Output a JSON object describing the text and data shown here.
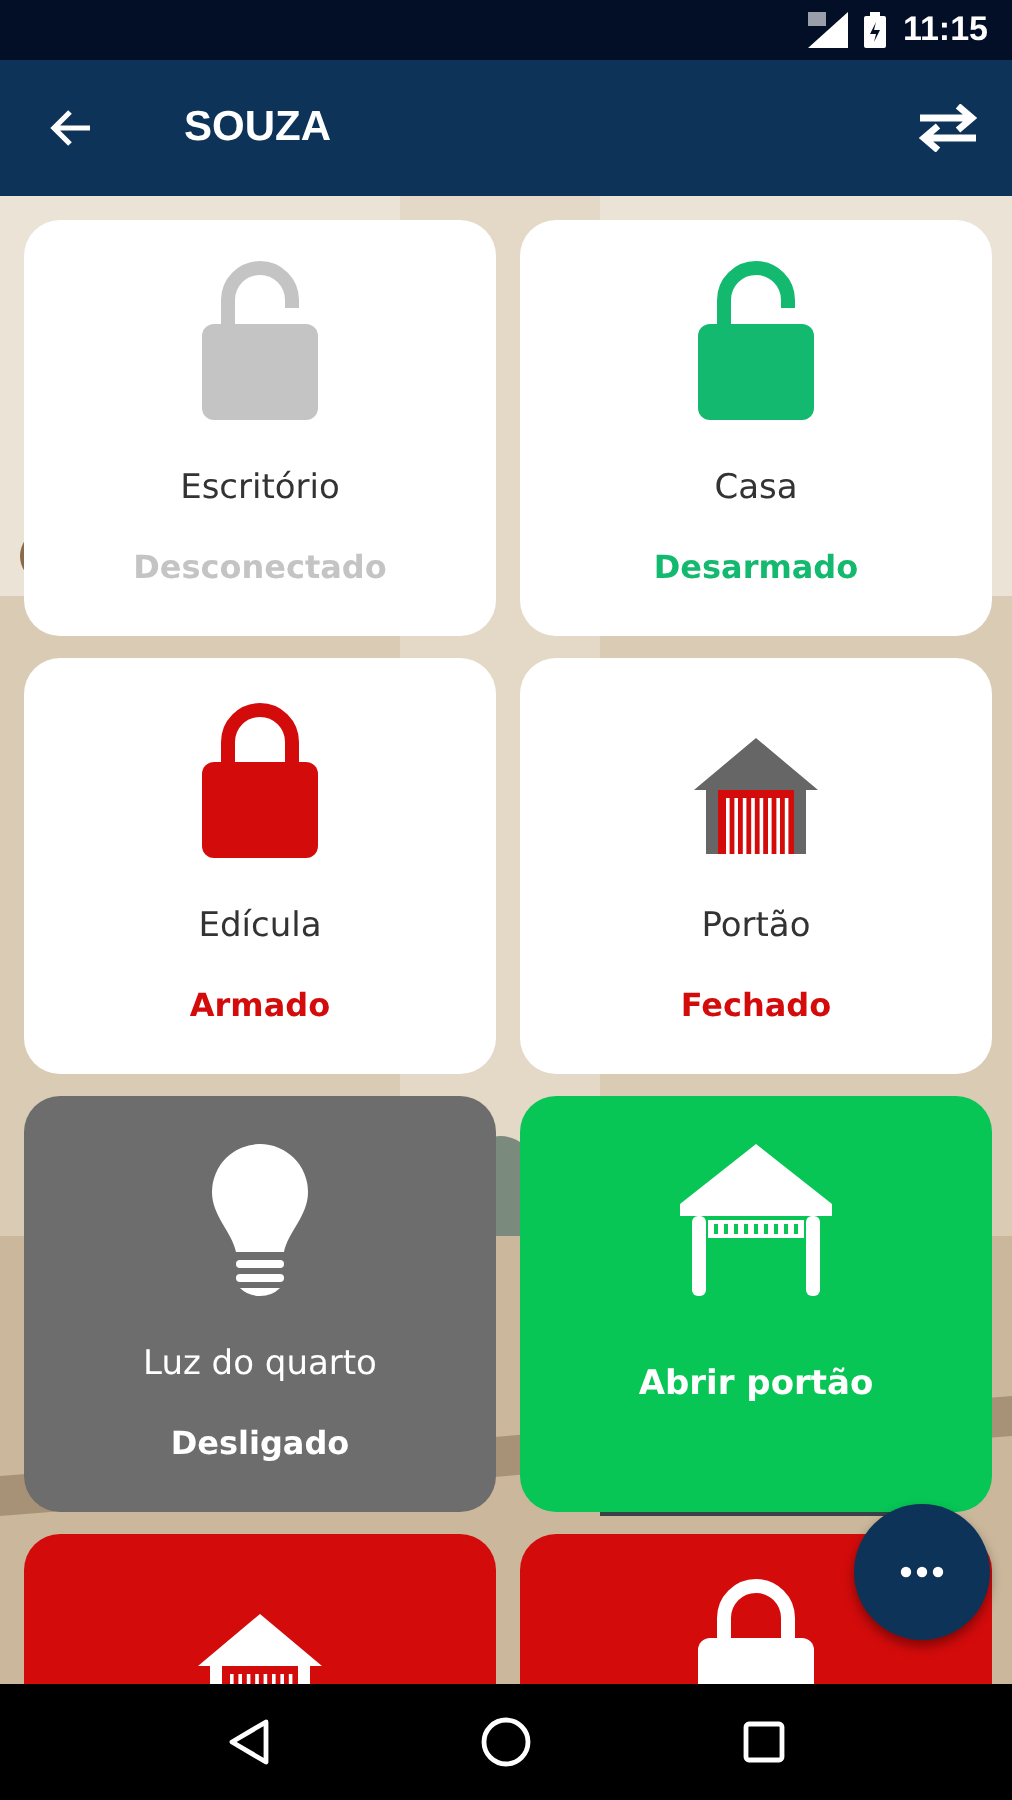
{
  "status_bar": {
    "time": "11:15"
  },
  "app_bar": {
    "title": "SOUZA"
  },
  "tiles": [
    {
      "kind": "lock",
      "locked": false,
      "filled": false,
      "color": "#c4c4c4",
      "label": "Escritório",
      "status": "Desconectado"
    },
    {
      "kind": "lock",
      "locked": false,
      "filled": false,
      "color": "#13b96e",
      "label": "Casa",
      "status": "Desarmado"
    },
    {
      "kind": "lock",
      "locked": true,
      "filled": false,
      "color": "#d40b0b",
      "label": "Edícula",
      "status": "Armado"
    },
    {
      "kind": "garage",
      "filled": false,
      "color": "#d40b0b",
      "label": "Portão",
      "status": "Fechado"
    },
    {
      "kind": "bulb",
      "filled": true,
      "color": "#6d6d6d",
      "label": "Luz do quarto",
      "status": "Desligado"
    },
    {
      "kind": "gate",
      "filled": true,
      "color": "#07c655",
      "label": "Abrir portão"
    },
    {
      "kind": "garage",
      "filled": true,
      "color": "#d40b0b"
    },
    {
      "kind": "lock",
      "locked": true,
      "filled": true,
      "color": "#d40b0b"
    }
  ]
}
